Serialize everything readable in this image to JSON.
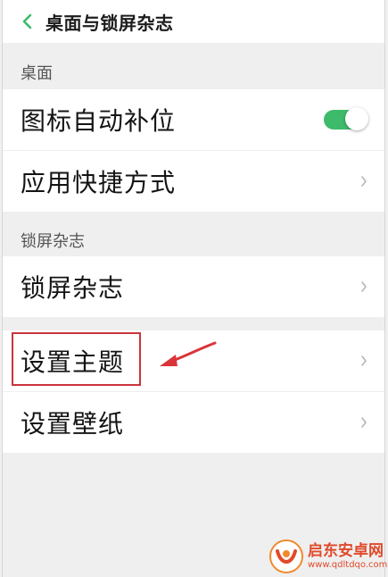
{
  "header": {
    "title": "桌面与锁屏杂志"
  },
  "sections": {
    "desktop_label": "桌面",
    "lockscreen_label": "锁屏杂志"
  },
  "rows": {
    "icon_autofill": "图标自动补位",
    "app_shortcuts": "应用快捷方式",
    "lockscreen_magazine": "锁屏杂志",
    "set_theme": "设置主题",
    "set_wallpaper": "设置壁纸"
  },
  "toggles": {
    "icon_autofill_on": true
  },
  "colors": {
    "accent_green": "#3dba6a",
    "annotation_red": "#c8353b"
  },
  "watermark": {
    "name": "启东安卓网",
    "url": "www.qdltdqo.com"
  }
}
